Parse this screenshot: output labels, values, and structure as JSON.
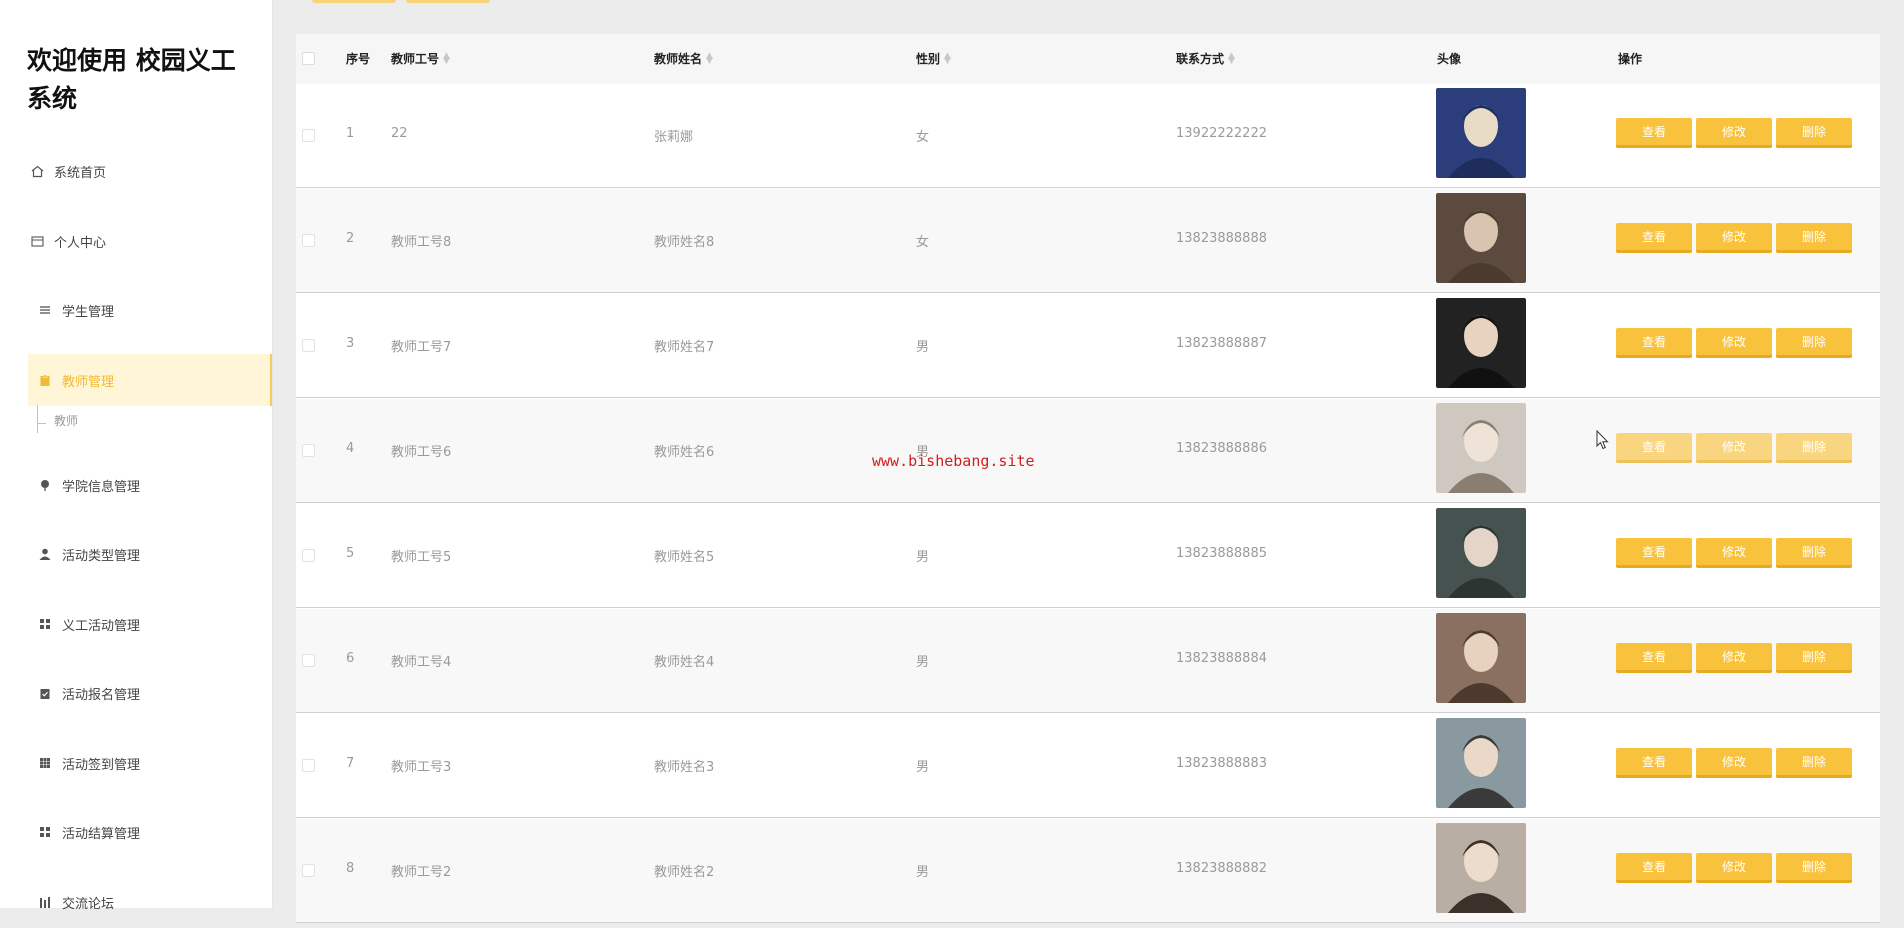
{
  "sidebar": {
    "title": "欢迎使用 校园义工系统",
    "items": [
      {
        "label": "系统首页",
        "icon": "home-icon"
      },
      {
        "label": "个人中心",
        "icon": "id-card-icon"
      },
      {
        "label": "学生管理",
        "icon": "list-icon"
      },
      {
        "label": "教师管理",
        "icon": "clipboard-icon",
        "active": true
      },
      {
        "label": "学院信息管理",
        "icon": "pin-icon"
      },
      {
        "label": "活动类型管理",
        "icon": "user-icon"
      },
      {
        "label": "义工活动管理",
        "icon": "grid-icon"
      },
      {
        "label": "活动报名管理",
        "icon": "clipboard-check-icon"
      },
      {
        "label": "活动签到管理",
        "icon": "grid-icon"
      },
      {
        "label": "活动结算管理",
        "icon": "grid-icon"
      },
      {
        "label": "交流论坛",
        "icon": "chart-icon"
      }
    ],
    "active_child": "教师"
  },
  "table": {
    "headers": [
      "序号",
      "教师工号",
      "教师姓名",
      "性别",
      "联系方式",
      "头像",
      "操作"
    ],
    "rows": [
      {
        "index": "1",
        "id": "22",
        "name": "张莉娜",
        "gender": "女",
        "phone": "13922222222"
      },
      {
        "index": "2",
        "id": "教师工号8",
        "name": "教师姓名8",
        "gender": "女",
        "phone": "13823888888"
      },
      {
        "index": "3",
        "id": "教师工号7",
        "name": "教师姓名7",
        "gender": "男",
        "phone": "13823888887"
      },
      {
        "index": "4",
        "id": "教师工号6",
        "name": "教师姓名6",
        "gender": "男",
        "phone": "13823888886"
      },
      {
        "index": "5",
        "id": "教师工号5",
        "name": "教师姓名5",
        "gender": "男",
        "phone": "13823888885"
      },
      {
        "index": "6",
        "id": "教师工号4",
        "name": "教师姓名4",
        "gender": "男",
        "phone": "13823888884"
      },
      {
        "index": "7",
        "id": "教师工号3",
        "name": "教师姓名3",
        "gender": "男",
        "phone": "13823888883"
      },
      {
        "index": "8",
        "id": "教师工号2",
        "name": "教师姓名2",
        "gender": "男",
        "phone": "13823888882"
      }
    ],
    "actions": {
      "view": "查看",
      "edit": "修改",
      "delete": "删除"
    }
  },
  "watermark": "www.bishebang.site",
  "colors": {
    "accent": "#f8c23c",
    "active_bg": "#fff6d8",
    "watermark": "#d01e1e"
  }
}
